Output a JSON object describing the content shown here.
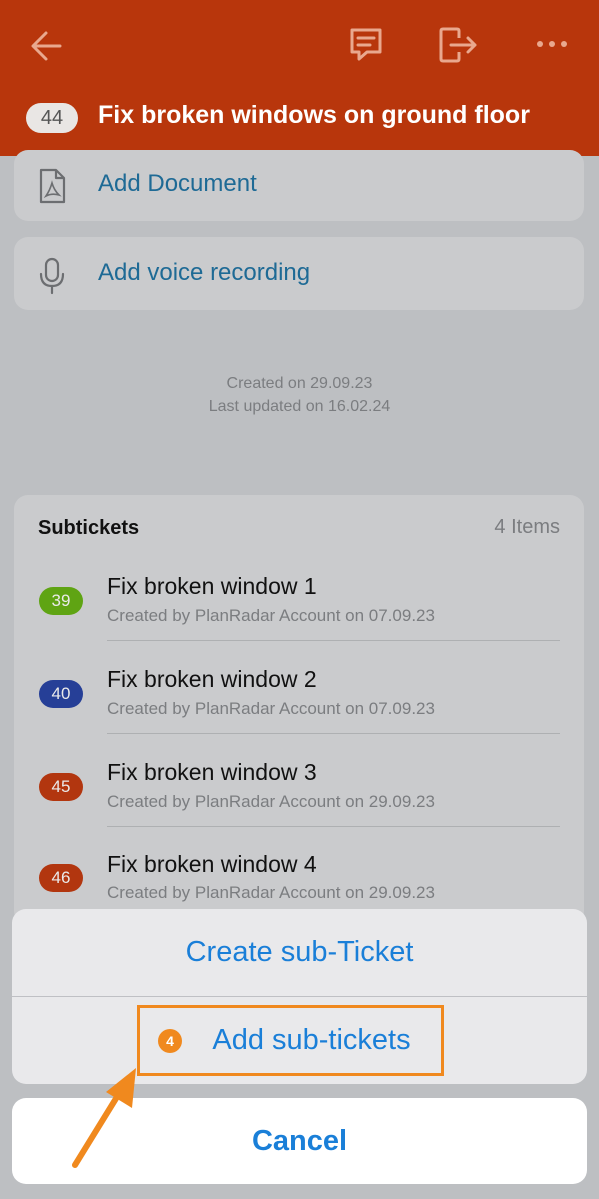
{
  "header": {
    "ticket_number": "44",
    "title": "Fix broken windows on ground floor",
    "background": "#b8360c"
  },
  "actions": {
    "add_document": "Add Document",
    "add_voice": "Add voice recording"
  },
  "meta": {
    "created": "Created on 29.09.23",
    "updated": "Last updated on 16.02.24"
  },
  "subtickets": {
    "title": "Subtickets",
    "count": "4 Items",
    "items": [
      {
        "number": "39",
        "name": "Fix broken window 1",
        "desc": "Created by PlanRadar Account on 07.09.23",
        "color": "#5fa413"
      },
      {
        "number": "40",
        "name": "Fix broken window 2",
        "desc": "Created by PlanRadar Account on 07.09.23",
        "color": "#263f97"
      },
      {
        "number": "45",
        "name": "Fix broken window 3",
        "desc": "Created by PlanRadar Account on 29.09.23",
        "color": "#b2360f"
      },
      {
        "number": "46",
        "name": "Fix broken window 4",
        "desc": "Created by PlanRadar Account on 29.09.23",
        "color": "#b2360f"
      }
    ]
  },
  "sheet": {
    "create": "Create sub-Ticket",
    "add": "Add sub-tickets",
    "cancel": "Cancel"
  },
  "annotation": {
    "step": "4",
    "color": "#f0891e"
  }
}
